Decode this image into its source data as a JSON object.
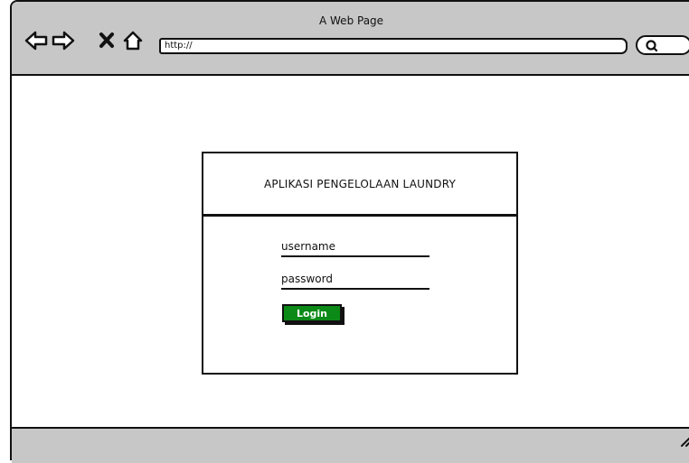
{
  "browser": {
    "title": "A Web Page",
    "url": "http://",
    "nav": {
      "back": "back-arrow-icon",
      "forward": "forward-arrow-icon",
      "stop": "close-icon",
      "home": "home-icon"
    },
    "search_icon": "search-icon"
  },
  "login": {
    "app_title": "APLIKASI PENGELOLAAN LAUNDRY",
    "username_label": "username",
    "password_label": "password",
    "login_label": "Login",
    "button_color": "#0b8a17"
  },
  "colors": {
    "chrome": "#c7c7c7",
    "stroke": "#111111",
    "background": "#ffffff"
  }
}
